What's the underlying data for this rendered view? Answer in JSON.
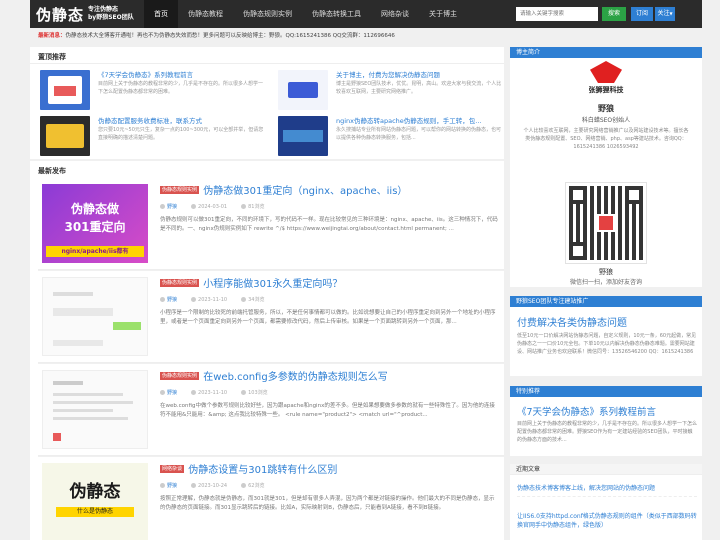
{
  "header": {
    "logo_main": "伪静态",
    "logo_sub1": "专注伪静态",
    "logo_sub2": "by野狼SEO团队",
    "nav": [
      "首页",
      "伪静态教程",
      "伪静态规则实例",
      "伪静态转换工具",
      "网络杂谈",
      "关于博主"
    ],
    "search_placeholder": "请输入关键字搜索",
    "search_label": "搜索",
    "subscribe_label": "订阅",
    "follow_label": "关注"
  },
  "notice": {
    "label": "最新消息：",
    "text": "伪静态技术大全博客开通啦！再也不为伪静态失效而愁！更多问题可以反映给博主：野狼。QQ:1615241386 QQ交流群：112696646"
  },
  "sticky": {
    "title": "置顶推荐",
    "items": [
      {
        "title": "《7天学会伪静态》系列教程前言",
        "desc": "目前网上关于伪静态的教程非常的少，几乎是不存在的。所以很多人想学一下怎么配置伪静态都非常的困难。"
      },
      {
        "title": "关于博主，付费为您解决伪静态问题",
        "desc": "博主是野狼SEO团队技术，优优。昆明，高山。欢迎大家与我交流，个人比较喜欢互联网，主要研究网络推广。"
      },
      {
        "title": "伪静态配置服务收费标准，联系方式",
        "desc": "您只要10元~50元只生，复杂一点的100~300元，可以全部并举，但请您直接明确的描述清楚问题。"
      },
      {
        "title": "nginx伪静态转apache伪静态规则，手工转，包...",
        "desc": "永久搜捕站专业所有网站伪静态问题，可以帮你的网站转换的伪静态，也可以提供各种伪静态转换服务，包括..."
      }
    ]
  },
  "latest": {
    "title": "最新发布",
    "articles": [
      {
        "category": "伪静态规则实例",
        "title": "伪静态做301重定向（nginx、apache、iis）",
        "author": "野狼",
        "date": "2024-03-01",
        "views": "81浏览",
        "excerpt": "伪静态规则可以做301重定向，不同的环境下，写的代码不一样。现在比较常见的三种环境是：nginx、apache、iis。这三种情况下，代码是不同的。一、nginx伪规则实例如下 rewrite ^/$ https://www.weijingtai.org/about/contact.html permanent; ...",
        "thumb_line1": "伪静态做",
        "thumb_line2": "301重定向",
        "thumb_line3": "nginx/apache/iis都有"
      },
      {
        "category": "伪静态规则实例",
        "title": "小程序能做301永久重定向吗？",
        "author": "野狼",
        "date": "2023-11-10",
        "views": "34浏览",
        "excerpt": "小程序是一个限制的比较死的前端托管服务，所以，不是任何事情都可以做的。比如说想要让自己的小程序重定向到另外一个地址的小程序里，或者是一个页面重定向到另外一个页面，都需要修改代码，然后上传审核。如果是一个页面跳转到另外一个页面，那..."
      },
      {
        "category": "伪静态规则实例",
        "title": "在web.config多参数的伪静态规则怎么写",
        "author": "野狼",
        "date": "2023-11-10",
        "views": "103浏览",
        "excerpt": "在web.config中做个参数写规则比较好些，因为跟apache和nginx的差不多。但是如果想要做多参数的就有一些特殊性了。因为他的连接符不能用&只能用：&amp; 这点我比较特殊一些。 <rule name=\"product2\"> <match url=\"^product..."
      },
      {
        "category": "网络杂谈",
        "title": "伪静态设置与301跳转有什么区别",
        "author": "野狼",
        "date": "2023-10-24",
        "views": "62浏览",
        "excerpt": "按照正常理解，伪静态就是伪静态，而301就是301，但是却有很多人弄混，因为两个都是对链接的操作。他们最大的不同是伪静态，显示的伪静态的页面链接。而301显示跳转后的链接。比如A，实际映射到B，伪静态后，只能看到A链接，看不到B链接。",
        "thumb_line1": "伪静态",
        "thumb_line2": "什么是伪静态"
      }
    ]
  },
  "sidebar": {
    "about": {
      "title": "博主简介",
      "logo_text": "张狮狸科技",
      "name": "野狼",
      "role": "科白蜡SEO创始人",
      "desc": "个人比较喜欢互联网，主要研究网络营销推广以及网站建设技术等。擅长各类伪静态规则配置、SEO、网络营销、php、asp等建站技术。咨询QQ：1615241386 1026593492"
    },
    "qr": {
      "name": "野狼",
      "caption": "微信扫一扫，添加好友咨询"
    },
    "promo": {
      "title": "野狼SEO团队专注建站推广",
      "heading": "付费解决各类伪静态问题",
      "desc": "低至10元一口价解决网站伪静态问题，自定义规则，10元一条，60元起做，常见伪静态之一一口价10元全包。下单10元以内解决伪静态伪静态难题。需要网站建设、网站推广业务也欢迎联系！微信同号：13526546200 QQ：1615241386"
    },
    "featured": {
      "title": "特别推荐",
      "heading": "《7天学会伪静态》系列教程前言",
      "desc": "目前网上关于伪静态的教程非常的少，几乎是不存在的。所以很多人想学一下怎么配置伪静态都非常的困难。野狼SEO作为有一定建站经验的SEO团队，平时接触的伪静态方面的技术..."
    },
    "recent": {
      "title": "近期文章",
      "items": [
        "伪静态技术博客博客上线，解决您网站的伪静态问题",
        "让IIS6.0支持httpd.conf格式伪静态规则的组件（类似于西部数码转换官网手中伪静态组件，绿色版）"
      ]
    }
  },
  "colors": {
    "header_bg": "#2b2b2b",
    "link_blue": "#2e7fd3",
    "tag_red": "#d9534f",
    "search_green": "#2ba245"
  }
}
